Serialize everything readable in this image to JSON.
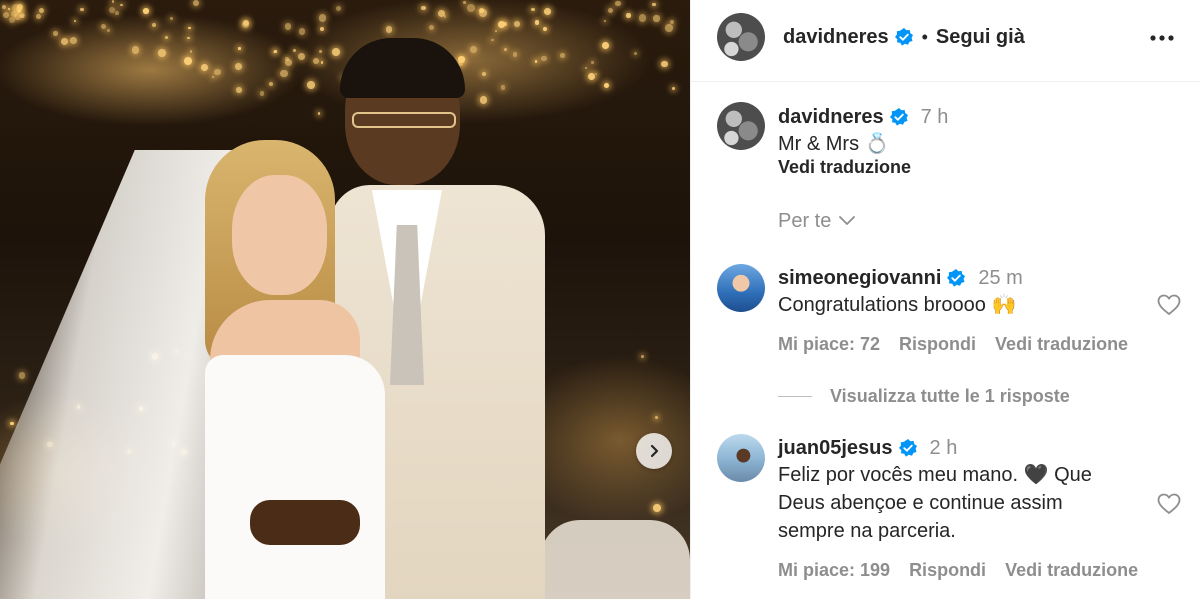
{
  "header": {
    "username": "davidneres",
    "separator": "•",
    "follow_status": "Segui già",
    "more_icon": "more-horizontal-icon"
  },
  "caption": {
    "username": "davidneres",
    "time": "7 h",
    "text": "Mr & Mrs 💍",
    "translate": "Vedi traduzione"
  },
  "sort": {
    "label": "Per te"
  },
  "comments": [
    {
      "username": "simeonegiovanni",
      "time": "25 m",
      "text": "Congratulations broooo 🙌",
      "likes": "Mi piace: 72",
      "reply": "Rispondi",
      "translate": "Vedi traduzione",
      "replies_toggle": "Visualizza tutte le 1 risposte"
    },
    {
      "username": "juan05jesus",
      "time": "2 h",
      "text_line1": "Feliz por vocês meu mano. 🖤 Que",
      "text_line2": "Deus abençoe e continue assim",
      "text_line3": "sempre na parceria.",
      "likes": "Mi piace: 199",
      "reply": "Rispondi",
      "translate": "Vedi traduzione"
    }
  ],
  "colors": {
    "verified": "#0095f6",
    "muted": "#8e8e8e",
    "text": "#262626"
  },
  "icons": {
    "verified": "verified-badge-icon",
    "chevron": "chevron-down-icon",
    "heart": "heart-outline-icon",
    "next": "chevron-right-icon"
  }
}
